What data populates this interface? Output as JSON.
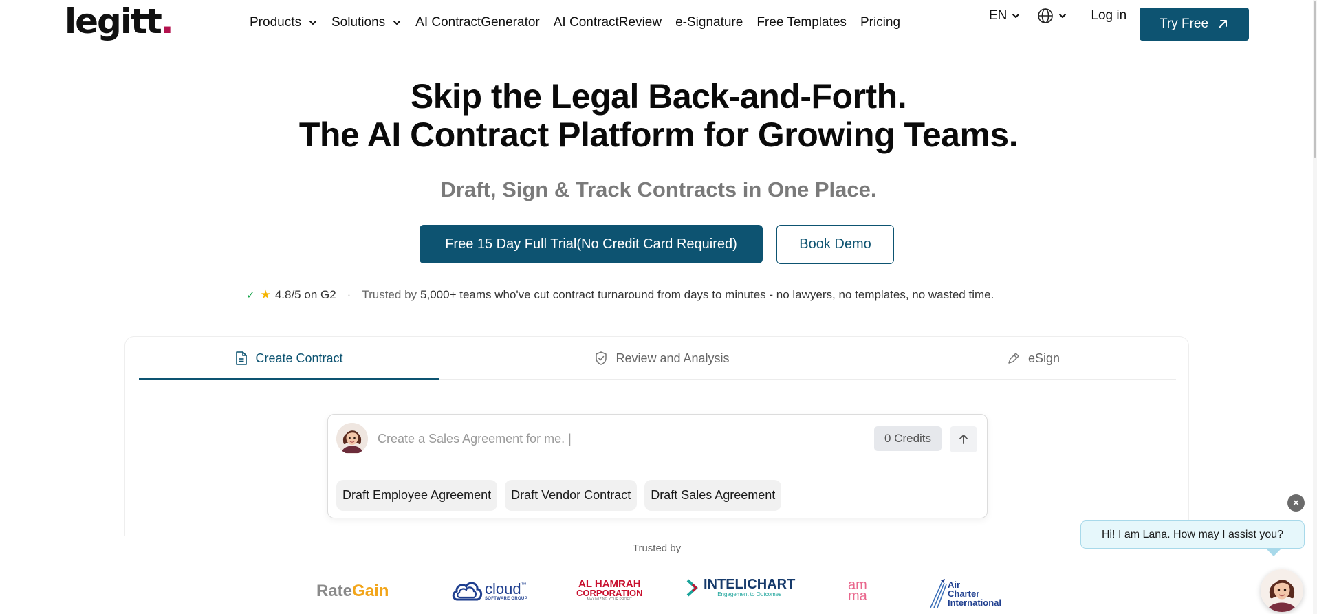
{
  "header": {
    "logo_text": "legitt",
    "logo_dot": ".",
    "nav": [
      {
        "label": "Products",
        "dropdown": true
      },
      {
        "label": "Solutions",
        "dropdown": true
      },
      {
        "label": "AI ContractGenerator",
        "dropdown": false
      },
      {
        "label": "AI ContractReview",
        "dropdown": false
      },
      {
        "label": "e-Signature",
        "dropdown": false
      },
      {
        "label": "Free Templates",
        "dropdown": false
      },
      {
        "label": "Pricing",
        "dropdown": false
      }
    ],
    "language": "EN",
    "login": "Log in",
    "try_free": "Try Free"
  },
  "hero": {
    "title_line1": "Skip the Legal Back-and-Forth.",
    "title_line2": "The AI Contract Platform for Growing Teams.",
    "subtitle": "Draft, Sign & Track Contracts in One Place.",
    "primary_cta": "Free 15 Day Full Trial(No Credit Card Required)",
    "secondary_cta": "Book Demo"
  },
  "trust": {
    "rating": "4.8/5 on G2",
    "separator": "·",
    "trusted_by_prefix": "Trusted by",
    "trusted_by_text": "5,000+ teams who've cut contract turnaround from days to minutes - no lawyers, no templates, no wasted time."
  },
  "tabs": [
    {
      "label": "Create Contract",
      "icon": "document-icon",
      "active": true
    },
    {
      "label": "Review and Analysis",
      "icon": "shield-check-icon",
      "active": false
    },
    {
      "label": "eSign",
      "icon": "pen-icon",
      "active": false
    }
  ],
  "prompt": {
    "placeholder": "Create a Sales Agreement for me. |",
    "credits": "0 Credits",
    "chips": [
      "Draft Employee Agreement",
      "Draft Vendor Contract",
      "Draft Sales Agreement"
    ]
  },
  "trusted": {
    "label": "Trusted by",
    "logos": {
      "rategain_a": "Rate",
      "rategain_b": "Gain",
      "cloud": "cloud",
      "cloud_tm": "™",
      "cloud_sub": "SOFTWARE GROUP",
      "alhamrah_1": "AL HAMRAH",
      "alhamrah_2": "CORPORATION",
      "alhamrah_3": "MAXIMIZING YOUR PROFIT",
      "intelichart": "INTELICHART",
      "intelichart_sub": "Engagement to Outcomes",
      "amma_1": "am",
      "amma_2": "ma",
      "air_1": "Air",
      "air_2": "Charter",
      "air_3": "International"
    }
  },
  "chat": {
    "greeting": "Hi! I am Lana. How may I assist you?",
    "close": "×"
  },
  "colors": {
    "brand": "#0d5371",
    "logo_dot": "#b3124e",
    "star": "#f5b400",
    "check": "#16a34a"
  }
}
